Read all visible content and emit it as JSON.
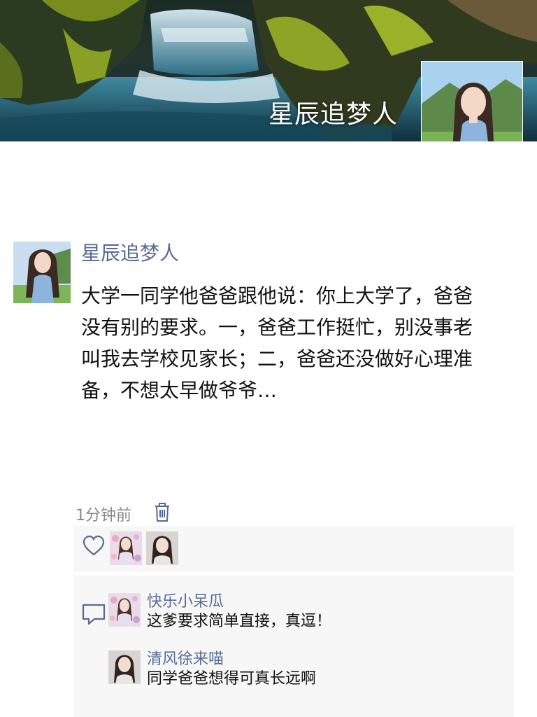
{
  "cover": {
    "username": "星辰追梦人"
  },
  "post": {
    "author": "星辰追梦人",
    "content": "大学一同学他爸爸跟他说：你上大学了，爸爸\n没有别的要求。一，爸爸工作挺忙，别没事老\n叫我去学校见家长；二，爸爸还没做好心理准\n备，不想太早做爷爷…",
    "time": "1分钟前"
  },
  "likes": {
    "avatars": [
      "avatar-girl-flowers",
      "avatar-girl-portrait"
    ]
  },
  "comments": [
    {
      "author": "快乐小呆瓜",
      "text": "这爹要求简单直接，真逗！"
    },
    {
      "author": "清风徐来喵",
      "text": "同学爸爸想得可真长远啊"
    }
  ],
  "colors": {
    "link": "#576b95",
    "panel_bg": "#f7f7f7",
    "text": "#111111",
    "meta": "#888888"
  }
}
